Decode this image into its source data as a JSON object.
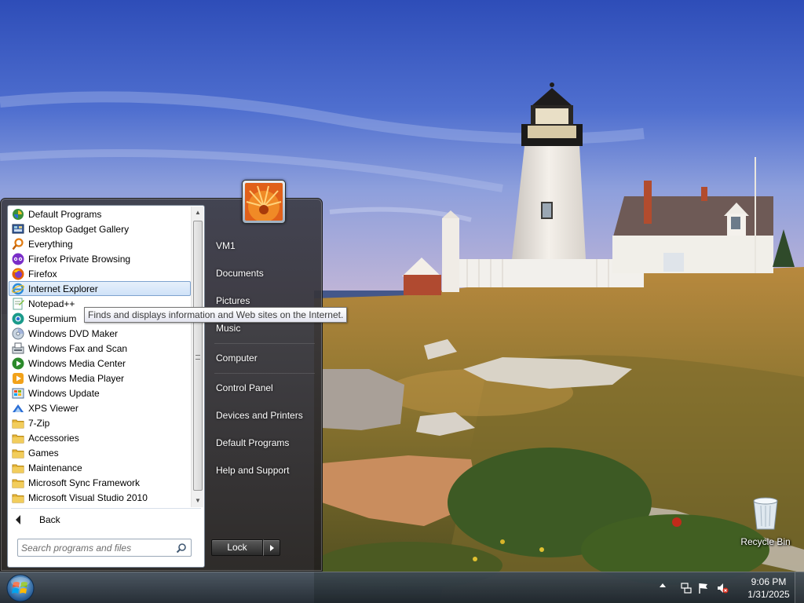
{
  "start_menu": {
    "programs": [
      {
        "label": "Default Programs",
        "icon": "default-programs-icon"
      },
      {
        "label": "Desktop Gadget Gallery",
        "icon": "gadget-gallery-icon"
      },
      {
        "label": "Everything",
        "icon": "everything-search-icon"
      },
      {
        "label": "Firefox Private Browsing",
        "icon": "firefox-private-icon"
      },
      {
        "label": "Firefox",
        "icon": "firefox-icon"
      },
      {
        "label": "Internet Explorer",
        "icon": "internet-explorer-icon",
        "selected": true
      },
      {
        "label": "Notepad++",
        "icon": "notepad-plus-plus-icon"
      },
      {
        "label": "Supermium",
        "icon": "supermium-icon"
      },
      {
        "label": "Windows DVD Maker",
        "icon": "dvd-maker-icon"
      },
      {
        "label": "Windows Fax and Scan",
        "icon": "fax-scan-icon"
      },
      {
        "label": "Windows Media Center",
        "icon": "media-center-icon"
      },
      {
        "label": "Windows Media Player",
        "icon": "media-player-icon"
      },
      {
        "label": "Windows Update",
        "icon": "windows-update-icon"
      },
      {
        "label": "XPS Viewer",
        "icon": "xps-viewer-icon"
      },
      {
        "label": "7-Zip",
        "icon": "folder-icon"
      },
      {
        "label": "Accessories",
        "icon": "folder-icon"
      },
      {
        "label": "Games",
        "icon": "folder-icon"
      },
      {
        "label": "Maintenance",
        "icon": "folder-icon"
      },
      {
        "label": "Microsoft Sync Framework",
        "icon": "folder-icon"
      },
      {
        "label": "Microsoft Visual Studio 2010",
        "icon": "folder-icon"
      }
    ],
    "back_label": "Back",
    "search_placeholder": "Search programs and files",
    "right_items": {
      "user": "VM1",
      "documents": "Documents",
      "pictures": "Pictures",
      "music": "Music",
      "computer": "Computer",
      "control_panel": "Control Panel",
      "devices": "Devices and Printers",
      "default_programs": "Default Programs",
      "help": "Help and Support"
    },
    "lock_label": "Lock"
  },
  "tooltip": "Finds and displays information and Web sites on the Internet.",
  "desktop": {
    "recycle_bin": "Recycle Bin"
  },
  "taskbar": {
    "time": "9:06 PM",
    "date": "1/31/2025"
  },
  "colors": {
    "selection_border": "#7da2ce",
    "taskbar": "#2c3640",
    "sky": "#3a5bbf"
  }
}
